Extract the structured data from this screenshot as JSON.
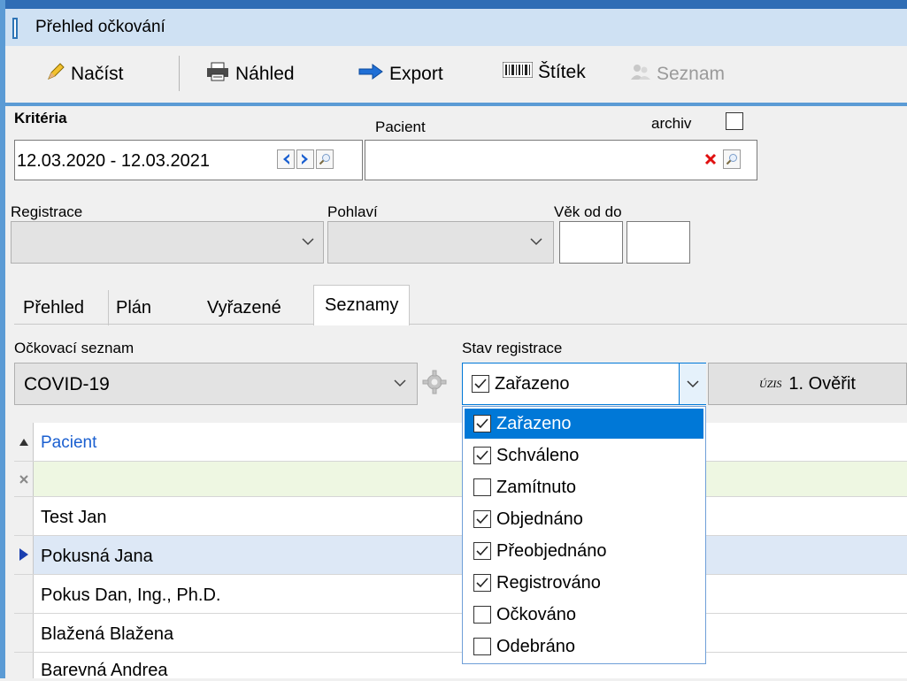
{
  "window": {
    "title": "Přehled očkování"
  },
  "toolbar": {
    "load_label": "Načíst",
    "preview_label": "Náhled",
    "export_label": "Export",
    "label_label": "Štítek",
    "list_label": "Seznam"
  },
  "criteria": {
    "heading": "Kritéria",
    "date_range": "12.03.2020 - 12.03.2021",
    "patient_label": "Pacient",
    "patient_value": "",
    "archive_label": "archiv",
    "archive_checked": false,
    "registration_label": "Registrace",
    "registration_value": "",
    "gender_label": "Pohlaví",
    "gender_value": "",
    "age_label": "Věk od do",
    "age_from": "",
    "age_to": ""
  },
  "tabs": [
    {
      "label": "Přehled",
      "active": false
    },
    {
      "label": "Plán",
      "active": false
    },
    {
      "label": "Vyřazené",
      "active": false
    },
    {
      "label": "Seznamy",
      "active": true
    }
  ],
  "lists": {
    "vaccination_list_label": "Očkovací seznam",
    "vaccination_list_value": "COVID-19",
    "registration_status_label": "Stav registrace",
    "registration_status_value": "Zařazeno",
    "verify_prefix": "ÚZIS",
    "verify_label": "1. Ověřit"
  },
  "status_options": [
    {
      "label": "Zařazeno",
      "checked": true,
      "selected": true
    },
    {
      "label": "Schváleno",
      "checked": true,
      "selected": false
    },
    {
      "label": "Zamítnuto",
      "checked": false,
      "selected": false
    },
    {
      "label": "Objednáno",
      "checked": true,
      "selected": false
    },
    {
      "label": "Přeobjednáno",
      "checked": true,
      "selected": false
    },
    {
      "label": "Registrováno",
      "checked": true,
      "selected": false
    },
    {
      "label": "Očkováno",
      "checked": false,
      "selected": false
    },
    {
      "label": "Odebráno",
      "checked": false,
      "selected": false
    }
  ],
  "grid": {
    "column_header": "Pacient",
    "rows": [
      "Test Jan",
      "Pokusná Jana",
      "Pokus Dan, Ing., Ph.D.",
      "Blažená  Blažena",
      "Barevná Andrea"
    ],
    "current_row": 1
  },
  "colors": {
    "title_bar": "#cfe1f3",
    "accent_blue": "#0078d7",
    "selected_row": "#dde8f6",
    "filter_row": "#eef7e2"
  }
}
